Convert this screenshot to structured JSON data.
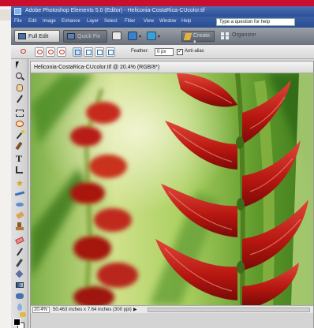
{
  "window": {
    "title": "Adobe Photoshop Elements 5.0 (Editor) - Heliconia-CostaRica-CUcolor.tif"
  },
  "menu": {
    "items": [
      "File",
      "Edit",
      "Image",
      "Enhance",
      "Layer",
      "Select",
      "Filter",
      "View",
      "Window",
      "Help"
    ],
    "help_placeholder": "Type a question for help"
  },
  "shortcuts": {
    "full_edit": "Full Edit",
    "quick_fix": "Quick Fix",
    "create": "Create",
    "organize": "Organizer"
  },
  "options": {
    "feather_label": "Feather:",
    "feather_value": "0 px",
    "antialias_label": "Anti-alias",
    "antialias_checked": true
  },
  "document": {
    "title": "Heliconia-CostaRica-CUcolor.tif @ 20.4% (RGB/8*)",
    "zoom": "20.4%",
    "size": "50.463 inches x 7.64 inches (300 ppi)",
    "status_arrow": "▶"
  },
  "icons": {
    "tools": [
      "move-tool-icon",
      "zoom-tool-icon",
      "hand-tool-icon",
      "eyedropper-tool-icon",
      "marquee-tool-icon",
      "lasso-tool-icon",
      "magic-wand-tool-icon",
      "selection-brush-tool-icon",
      "type-tool-icon",
      "crop-tool-icon",
      "cookie-cutter-tool-icon",
      "straighten-tool-icon",
      "red-eye-tool-icon",
      "healing-brush-tool-icon",
      "clone-stamp-tool-icon",
      "eraser-tool-icon",
      "pencil-tool-icon",
      "brush-tool-icon",
      "paint-bucket-tool-icon",
      "gradient-tool-icon",
      "shape-tool-icon",
      "blur-tool-icon",
      "sponge-tool-icon"
    ]
  },
  "colors": {
    "accent_red": "#c8102e",
    "menu_blue": "#2b4f95",
    "flower_red": "#b81a18",
    "foreground_swatch": "#000000",
    "background_swatch": "#ffffff"
  }
}
